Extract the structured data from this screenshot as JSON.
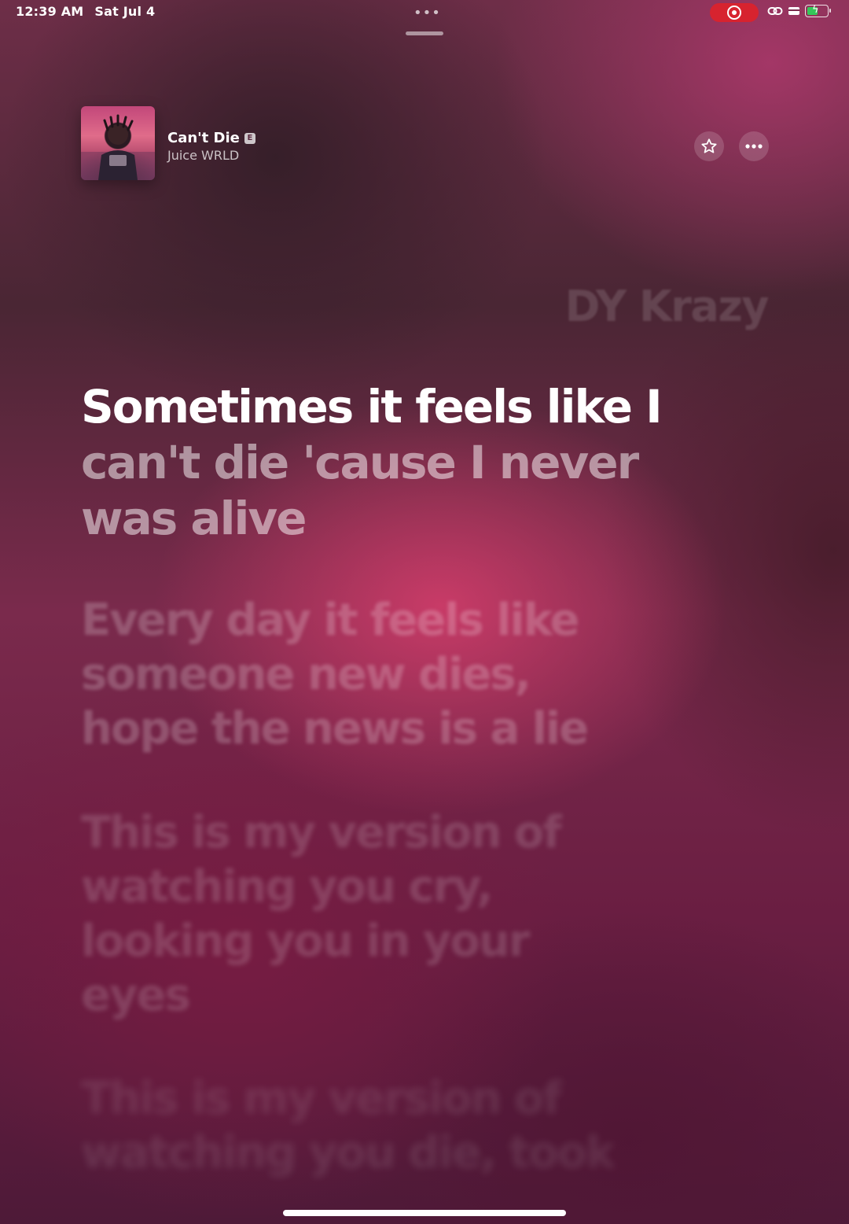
{
  "status_bar": {
    "time": "12:39 AM",
    "date": "Sat Jul 4",
    "top_dots": "•••",
    "battery_percent": 55,
    "colors": {
      "record": "#d7232f",
      "battery_charging": "#35c759"
    }
  },
  "now_playing": {
    "title": "Can't Die",
    "explicit_badge": "E",
    "artist": "Juice WRLD",
    "more_glyph": "•••",
    "artwork_icon": "album-artwork"
  },
  "lyrics": {
    "credit": "DY Krazy",
    "active_sung": "Sometimes it feels like I",
    "active_pending": "can't die 'cause I never was alive",
    "next_1": "Every day it feels like someone new dies, hope the news is a lie",
    "next_2": "This is my version of watching you cry, looking you in your eyes",
    "next_3": "This is my version of watching you die, took"
  }
}
